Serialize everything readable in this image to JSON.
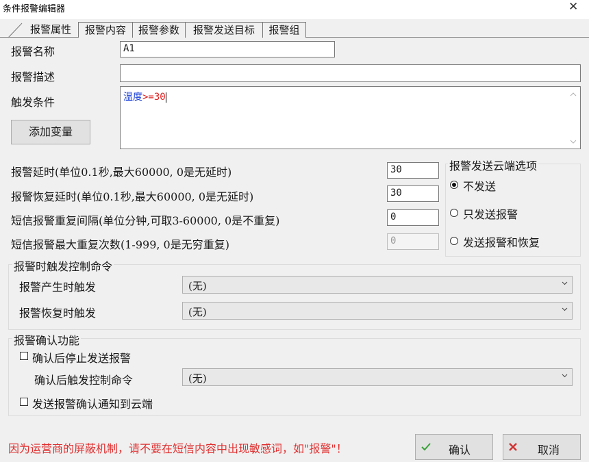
{
  "window": {
    "title": "条件报警编辑器",
    "close": "✕"
  },
  "tabs": [
    "报警属性",
    "报警内容",
    "报警参数",
    "报警发送目标",
    "报警组"
  ],
  "fields": {
    "name_label": "报警名称",
    "name_value": "A1",
    "desc_label": "报警描述",
    "desc_value": "",
    "trigger_label": "触发条件",
    "trigger_var": "温度",
    "trigger_op": ">=",
    "trigger_num": "30",
    "add_var_button": "添加变量"
  },
  "params": {
    "delay_label": "报警延时(单位0.1秒,最大60000, 0是无延时)",
    "delay_value": "30",
    "recover_label": "报警恢复延时(单位0.1秒,最大60000, 0是无延时)",
    "recover_value": "30",
    "sms_interval_label": "短信报警重复间隔(单位分钟,可取3-60000, 0是不重复)",
    "sms_interval_value": "0",
    "sms_max_label": "短信报警最大重复次数(1-999, 0是无穷重复)",
    "sms_max_value": "0"
  },
  "cloud": {
    "title": "报警发送云端选项",
    "options": [
      "不发送",
      "只发送报警",
      "发送报警和恢复"
    ],
    "selected": 0
  },
  "control": {
    "title": "报警时触发控制命令",
    "on_alarm_label": "报警产生时触发",
    "on_alarm_value": "(无)",
    "on_recover_label": "报警恢复时触发",
    "on_recover_value": "(无)"
  },
  "confirm": {
    "title": "报警确认功能",
    "stop_label": "确认后停止发送报警",
    "stop_checked": false,
    "cmd_label": "确认后触发控制命令",
    "cmd_value": "(无)",
    "notify_label": "发送报警确认通知到云端",
    "notify_checked": false
  },
  "footer": {
    "warning": "因为运营商的屏蔽机制，请不要在短信内容中出现敏感词，如\"报警\"！",
    "ok": "确认",
    "cancel": "取消"
  },
  "colors": {
    "warning": "#e03030",
    "ok_icon": "#3aa03a",
    "cancel_icon": "#d03030",
    "trigger_var": "#1a3fd6",
    "trigger_op": "#e02020"
  }
}
